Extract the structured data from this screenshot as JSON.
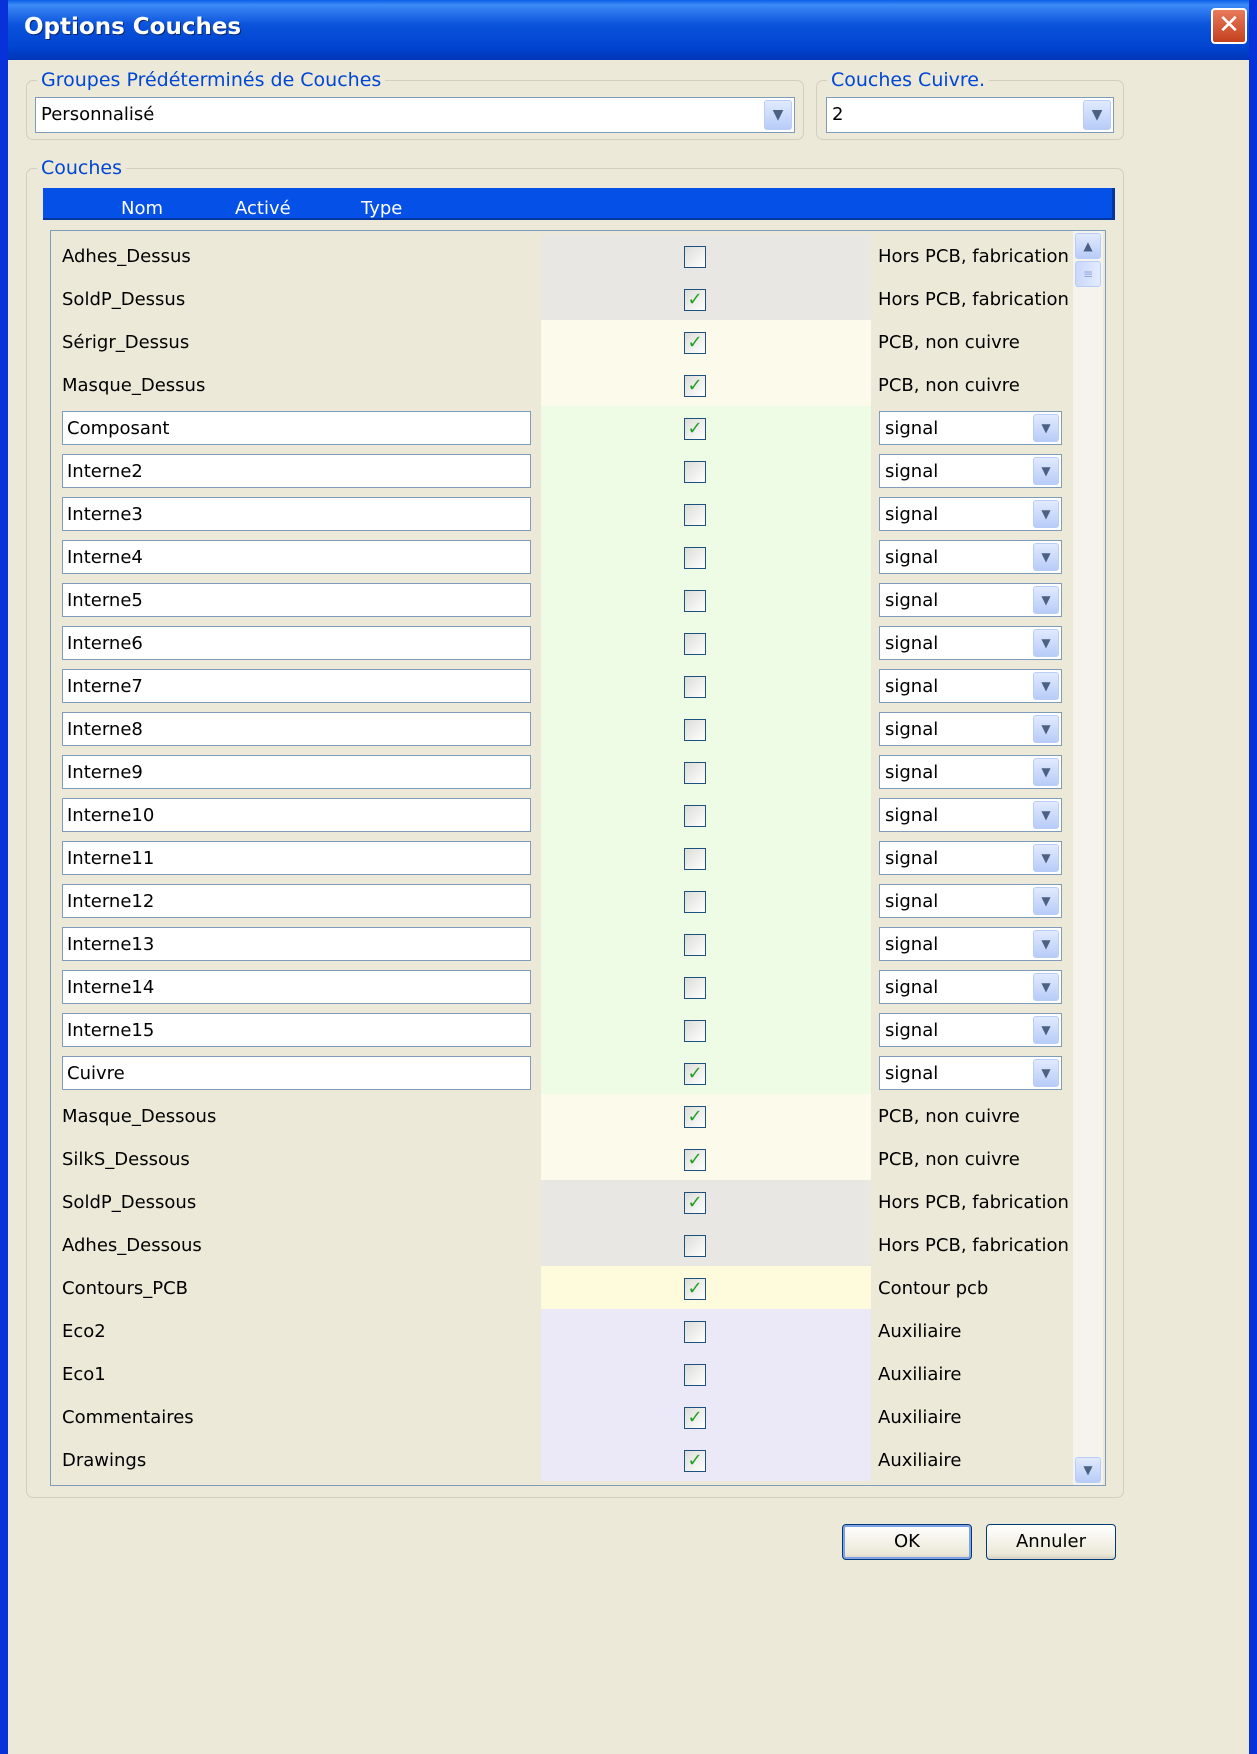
{
  "window": {
    "title": "Options Couches",
    "close_glyph": "✕"
  },
  "presets": {
    "label": "Groupes Prédéterminés de Couches",
    "selected": "Personnalisé"
  },
  "copper": {
    "label": "Couches Cuivre.",
    "selected": "2"
  },
  "layers": {
    "label": "Couches",
    "columns": {
      "name": "Nom",
      "enabled": "Activé",
      "type": "Type"
    },
    "rows": [
      {
        "name": "Adhes_Dessus",
        "editable": false,
        "checked": false,
        "type": "Hors PCB, fabrication",
        "type_combo": false,
        "color": "#e9e7e4"
      },
      {
        "name": "SoldP_Dessus",
        "editable": false,
        "checked": true,
        "type": "Hors PCB, fabrication",
        "type_combo": false,
        "color": "#e9e7e4"
      },
      {
        "name": "Sérigr_Dessus",
        "editable": false,
        "checked": true,
        "type": "PCB, non cuivre",
        "type_combo": false,
        "color": "#fbfaeb"
      },
      {
        "name": "Masque_Dessus",
        "editable": false,
        "checked": true,
        "type": "PCB, non cuivre",
        "type_combo": false,
        "color": "#fbfaeb"
      },
      {
        "name": "Composant",
        "editable": true,
        "checked": true,
        "type": "signal",
        "type_combo": true,
        "color": "#eefbe5"
      },
      {
        "name": "Interne2",
        "editable": true,
        "checked": false,
        "type": "signal",
        "type_combo": true,
        "color": "#eefbe5"
      },
      {
        "name": "Interne3",
        "editable": true,
        "checked": false,
        "type": "signal",
        "type_combo": true,
        "color": "#eefbe5"
      },
      {
        "name": "Interne4",
        "editable": true,
        "checked": false,
        "type": "signal",
        "type_combo": true,
        "color": "#eefbe5"
      },
      {
        "name": "Interne5",
        "editable": true,
        "checked": false,
        "type": "signal",
        "type_combo": true,
        "color": "#eefbe5"
      },
      {
        "name": "Interne6",
        "editable": true,
        "checked": false,
        "type": "signal",
        "type_combo": true,
        "color": "#eefbe5"
      },
      {
        "name": "Interne7",
        "editable": true,
        "checked": false,
        "type": "signal",
        "type_combo": true,
        "color": "#eefbe5"
      },
      {
        "name": "Interne8",
        "editable": true,
        "checked": false,
        "type": "signal",
        "type_combo": true,
        "color": "#eefbe5"
      },
      {
        "name": "Interne9",
        "editable": true,
        "checked": false,
        "type": "signal",
        "type_combo": true,
        "color": "#eefbe5"
      },
      {
        "name": "Interne10",
        "editable": true,
        "checked": false,
        "type": "signal",
        "type_combo": true,
        "color": "#eefbe5"
      },
      {
        "name": "Interne11",
        "editable": true,
        "checked": false,
        "type": "signal",
        "type_combo": true,
        "color": "#eefbe5"
      },
      {
        "name": "Interne12",
        "editable": true,
        "checked": false,
        "type": "signal",
        "type_combo": true,
        "color": "#eefbe5"
      },
      {
        "name": "Interne13",
        "editable": true,
        "checked": false,
        "type": "signal",
        "type_combo": true,
        "color": "#eefbe5"
      },
      {
        "name": "Interne14",
        "editable": true,
        "checked": false,
        "type": "signal",
        "type_combo": true,
        "color": "#eefbe5"
      },
      {
        "name": "Interne15",
        "editable": true,
        "checked": false,
        "type": "signal",
        "type_combo": true,
        "color": "#eefbe5"
      },
      {
        "name": "Cuivre",
        "editable": true,
        "checked": true,
        "type": "signal",
        "type_combo": true,
        "color": "#eefbe5"
      },
      {
        "name": "Masque_Dessous",
        "editable": false,
        "checked": true,
        "type": "PCB, non cuivre",
        "type_combo": false,
        "color": "#fbfaeb"
      },
      {
        "name": "SilkS_Dessous",
        "editable": false,
        "checked": true,
        "type": "PCB, non cuivre",
        "type_combo": false,
        "color": "#fbfaeb"
      },
      {
        "name": "SoldP_Dessous",
        "editable": false,
        "checked": true,
        "type": "Hors PCB, fabrication",
        "type_combo": false,
        "color": "#e9e7e4"
      },
      {
        "name": "Adhes_Dessous",
        "editable": false,
        "checked": false,
        "type": "Hors PCB, fabrication",
        "type_combo": false,
        "color": "#e9e7e4"
      },
      {
        "name": "Contours_PCB",
        "editable": false,
        "checked": true,
        "type": "Contour pcb",
        "type_combo": false,
        "color": "#fdfbdc"
      },
      {
        "name": "Eco2",
        "editable": false,
        "checked": false,
        "type": "Auxiliaire",
        "type_combo": false,
        "color": "#ebe8f7"
      },
      {
        "name": "Eco1",
        "editable": false,
        "checked": false,
        "type": "Auxiliaire",
        "type_combo": false,
        "color": "#ebe8f7"
      },
      {
        "name": "Commentaires",
        "editable": false,
        "checked": true,
        "type": "Auxiliaire",
        "type_combo": false,
        "color": "#ebe8f7"
      },
      {
        "name": "Drawings",
        "editable": false,
        "checked": true,
        "type": "Auxiliaire",
        "type_combo": false,
        "color": "#ebe8f7"
      }
    ]
  },
  "buttons": {
    "ok": "OK",
    "cancel": "Annuler"
  },
  "icons": {
    "dropdown": "chevron-down-icon",
    "check": "checkmark-icon",
    "scroll_up": "scroll-up-icon",
    "scroll_down": "scroll-down-icon"
  }
}
